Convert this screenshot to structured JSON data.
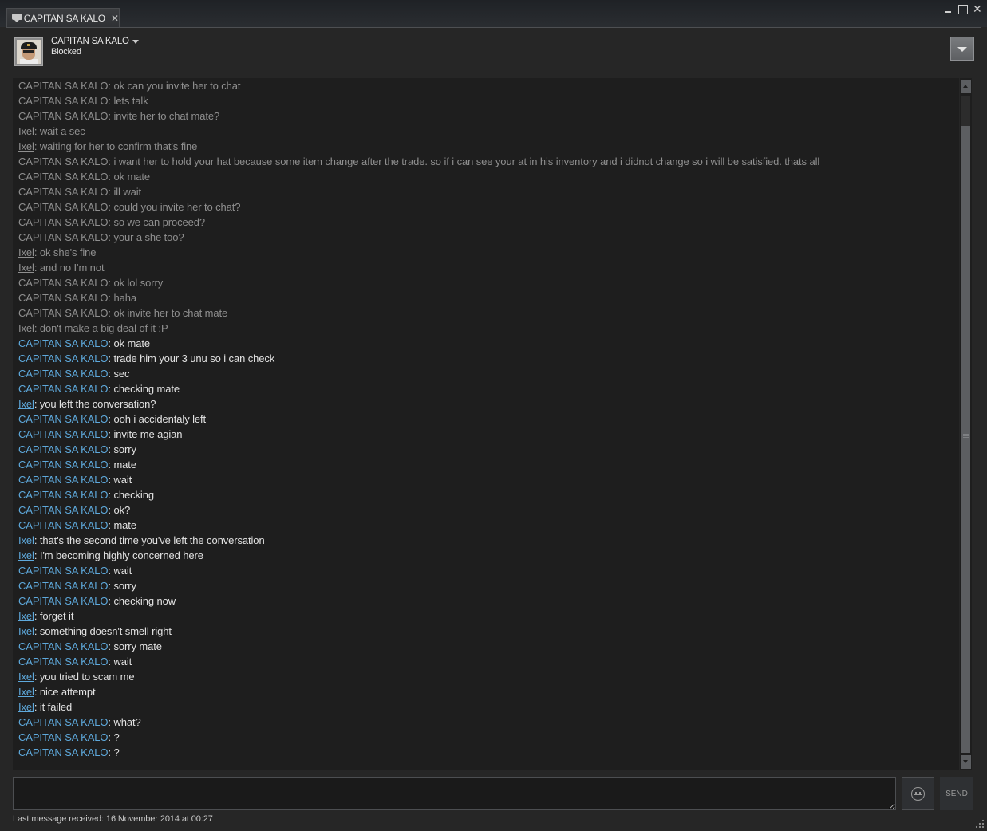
{
  "tab": {
    "title": "CAPITAN SA KALO",
    "icon": "chat-bubble-icon"
  },
  "window_controls": {
    "minimize": "minimize-icon",
    "maximize": "maximize-icon",
    "close": "close-icon"
  },
  "friend": {
    "name": "CAPITAN SA KALO",
    "status": "Blocked"
  },
  "colors": {
    "old_text": "#8f8f8f",
    "recent_name": "#5ea9dc",
    "recent_text": "#e2e2e2",
    "background": "#262626",
    "log_background": "#1e1e1e"
  },
  "messages": [
    {
      "sender": "CAPITAN SA KALO",
      "text": "ok can you invite her to chat",
      "self": false,
      "recent": false
    },
    {
      "sender": "CAPITAN SA KALO",
      "text": "lets talk",
      "self": false,
      "recent": false
    },
    {
      "sender": "CAPITAN SA KALO",
      "text": "invite her to chat mate?",
      "self": false,
      "recent": false
    },
    {
      "sender": "Ixel",
      "text": "wait a sec",
      "self": true,
      "recent": false
    },
    {
      "sender": "Ixel",
      "text": "waiting for her to confirm that's fine",
      "self": true,
      "recent": false
    },
    {
      "sender": "CAPITAN SA KALO",
      "text": "i want her to hold your hat because some item change after the trade. so if i can see your at in his inventory and i didnot change so i will be satisfied. thats all",
      "self": false,
      "recent": false
    },
    {
      "sender": "CAPITAN SA KALO",
      "text": "ok mate",
      "self": false,
      "recent": false
    },
    {
      "sender": "CAPITAN SA KALO",
      "text": "ill wait",
      "self": false,
      "recent": false
    },
    {
      "sender": "CAPITAN SA KALO",
      "text": "could you invite her to chat?",
      "self": false,
      "recent": false
    },
    {
      "sender": "CAPITAN SA KALO",
      "text": "so we can proceed?",
      "self": false,
      "recent": false
    },
    {
      "sender": "CAPITAN SA KALO",
      "text": "your a she too?",
      "self": false,
      "recent": false
    },
    {
      "sender": "Ixel",
      "text": "ok she's fine",
      "self": true,
      "recent": false
    },
    {
      "sender": "Ixel",
      "text": "and no I'm not",
      "self": true,
      "recent": false
    },
    {
      "sender": "CAPITAN SA KALO",
      "text": "ok lol sorry",
      "self": false,
      "recent": false
    },
    {
      "sender": "CAPITAN SA KALO",
      "text": "haha",
      "self": false,
      "recent": false
    },
    {
      "sender": "CAPITAN SA KALO",
      "text": "ok invite her to chat mate",
      "self": false,
      "recent": false
    },
    {
      "sender": "Ixel",
      "text": "don't make a big deal of it :P",
      "self": true,
      "recent": false
    },
    {
      "sender": "CAPITAN SA KALO",
      "text": "ok mate",
      "self": false,
      "recent": true
    },
    {
      "sender": "CAPITAN SA KALO",
      "text": "trade him your 3 unu so i can check",
      "self": false,
      "recent": true
    },
    {
      "sender": "CAPITAN SA KALO",
      "text": "sec",
      "self": false,
      "recent": true
    },
    {
      "sender": "CAPITAN SA KALO",
      "text": "checking mate",
      "self": false,
      "recent": true
    },
    {
      "sender": "Ixel",
      "text": "you left the conversation?",
      "self": true,
      "recent": true
    },
    {
      "sender": "CAPITAN SA KALO",
      "text": "ooh i accidentaly left",
      "self": false,
      "recent": true
    },
    {
      "sender": "CAPITAN SA KALO",
      "text": "invite me agian",
      "self": false,
      "recent": true
    },
    {
      "sender": "CAPITAN SA KALO",
      "text": "sorry",
      "self": false,
      "recent": true
    },
    {
      "sender": "CAPITAN SA KALO",
      "text": "mate",
      "self": false,
      "recent": true
    },
    {
      "sender": "CAPITAN SA KALO",
      "text": "wait",
      "self": false,
      "recent": true
    },
    {
      "sender": "CAPITAN SA KALO",
      "text": "checking",
      "self": false,
      "recent": true
    },
    {
      "sender": "CAPITAN SA KALO",
      "text": "ok?",
      "self": false,
      "recent": true
    },
    {
      "sender": "CAPITAN SA KALO",
      "text": "mate",
      "self": false,
      "recent": true
    },
    {
      "sender": "Ixel",
      "text": "that's the second time you've left the conversation",
      "self": true,
      "recent": true
    },
    {
      "sender": "Ixel",
      "text": "I'm becoming highly concerned here",
      "self": true,
      "recent": true
    },
    {
      "sender": "CAPITAN SA KALO",
      "text": "wait",
      "self": false,
      "recent": true
    },
    {
      "sender": "CAPITAN SA KALO",
      "text": "sorry",
      "self": false,
      "recent": true
    },
    {
      "sender": "CAPITAN SA KALO",
      "text": "checking now",
      "self": false,
      "recent": true
    },
    {
      "sender": "Ixel",
      "text": "forget it",
      "self": true,
      "recent": true
    },
    {
      "sender": "Ixel",
      "text": "something doesn't smell right",
      "self": true,
      "recent": true
    },
    {
      "sender": "CAPITAN SA KALO",
      "text": "sorry mate",
      "self": false,
      "recent": true
    },
    {
      "sender": "CAPITAN SA KALO",
      "text": "wait",
      "self": false,
      "recent": true
    },
    {
      "sender": "Ixel",
      "text": "you tried to scam me",
      "self": true,
      "recent": true
    },
    {
      "sender": "Ixel",
      "text": "nice attempt",
      "self": true,
      "recent": true
    },
    {
      "sender": "Ixel",
      "text": "it failed",
      "self": true,
      "recent": true
    },
    {
      "sender": "CAPITAN SA KALO",
      "text": "what?",
      "self": false,
      "recent": true
    },
    {
      "sender": "CAPITAN SA KALO",
      "text": "?",
      "self": false,
      "recent": true
    },
    {
      "sender": "CAPITAN SA KALO",
      "text": "?",
      "self": false,
      "recent": true
    }
  ],
  "composer": {
    "value": "",
    "emoticon_icon": "emoticon-icon",
    "send_label": "SEND"
  },
  "footer": {
    "last_message": "Last message received: 16 November 2014 at 00:27"
  }
}
